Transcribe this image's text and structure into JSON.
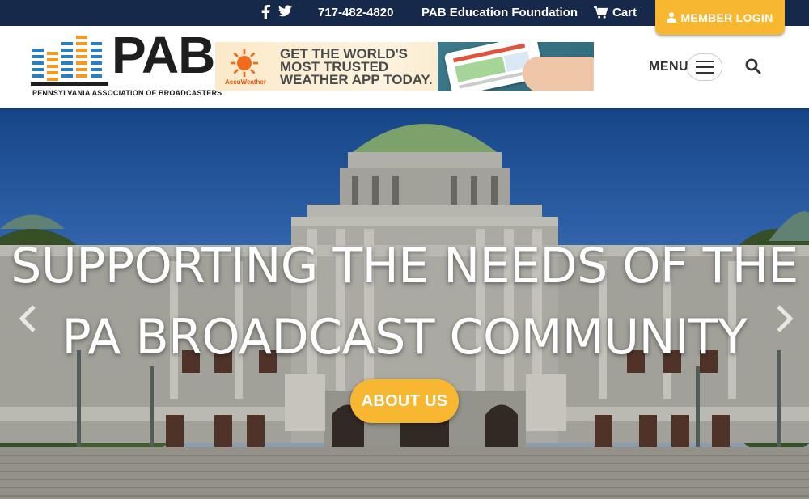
{
  "topbar": {
    "social": [
      {
        "icon": "facebook-icon"
      },
      {
        "icon": "twitter-icon"
      }
    ],
    "phone": "717-482-4820",
    "foundation_link": "PAB Education Foundation",
    "cart_label": "Cart",
    "member_login_label": "MEMBER LOGIN"
  },
  "header": {
    "logo_name": "PAB",
    "logo_tagline": "PENNSYLVANIA ASSOCIATION OF BROADCASTERS",
    "ad": {
      "brand": "AccuWeather",
      "line1": "GET THE WORLD'S",
      "line2": "MOST TRUSTED",
      "line3": "WEATHER APP TODAY."
    },
    "menu_label": "MENU"
  },
  "hero": {
    "title_line1": "SUPPORTING THE NEEDS OF THE",
    "title_line2": "PA BROADCAST COMMUNITY",
    "cta_label": "ABOUT US"
  },
  "colors": {
    "navy": "#17294b",
    "gold": "#f7b731",
    "logo_blue": "#2a7fc4",
    "logo_orange": "#f39a1e"
  }
}
